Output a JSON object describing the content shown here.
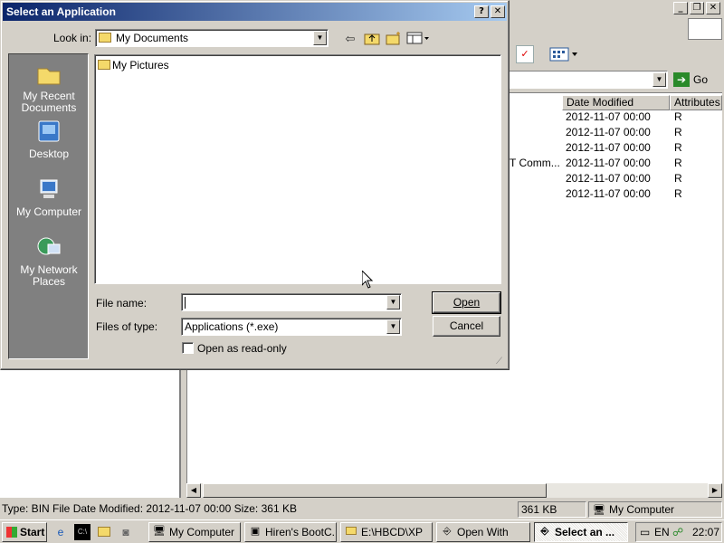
{
  "dialog": {
    "title": "Select an Application",
    "title_buttons": [
      "?",
      "✕"
    ],
    "look_in_label": "Look in:",
    "look_in_value": "My Documents",
    "toolbar_icons": [
      "back-icon",
      "up-folder-icon",
      "new-folder-icon",
      "view-menu-icon"
    ],
    "places": [
      {
        "label": "My Recent Documents",
        "icon": "recent-documents-icon"
      },
      {
        "label": "Desktop",
        "icon": "desktop-icon"
      },
      {
        "label": "My Computer",
        "icon": "my-computer-icon"
      },
      {
        "label": "My Network Places",
        "icon": "network-places-icon"
      }
    ],
    "files": [
      {
        "name": "My Pictures",
        "icon": "folder-icon"
      }
    ],
    "file_name_label": "File name:",
    "file_name_value": "",
    "files_of_type_label": "Files of type:",
    "files_of_type_value": "Applications (*.exe)",
    "read_only_label": "Open as read-only",
    "read_only_checked": false,
    "open_button": "Open",
    "cancel_button": "Cancel"
  },
  "background_window": {
    "caption_buttons": [
      "_",
      "❐",
      "✕"
    ],
    "go_label": "Go",
    "columns": [
      "Date Modified",
      "Attributes"
    ],
    "rows": [
      {
        "name": "",
        "date": "2012-11-07 00:00",
        "attr": "R"
      },
      {
        "name": "",
        "date": "2012-11-07 00:00",
        "attr": "R"
      },
      {
        "name": "",
        "date": "2012-11-07 00:00",
        "attr": "R"
      },
      {
        "name": "T Comm...",
        "date": "2012-11-07 00:00",
        "attr": "R"
      },
      {
        "name": "",
        "date": "2012-11-07 00:00",
        "attr": "R"
      },
      {
        "name": "",
        "date": "2012-11-07 00:00",
        "attr": "R"
      }
    ],
    "status": {
      "info": "Type: BIN File Date Modified: 2012-11-07 00:00 Size: 361 KB",
      "size": "361 KB",
      "location": "My Computer"
    }
  },
  "taskbar": {
    "start_label": "Start",
    "quick_launch": [
      "ie-icon",
      "cmd-icon",
      "folder-icon",
      "media-icon"
    ],
    "tasks": [
      {
        "label": "My Computer",
        "icon": "my-computer-icon",
        "active": false
      },
      {
        "label": "Hiren's BootC...",
        "icon": "hirens-icon",
        "active": false
      },
      {
        "label": "E:\\HBCD\\XP",
        "icon": "folder-icon",
        "active": false
      },
      {
        "label": "Open With",
        "icon": "open-with-icon",
        "active": false
      },
      {
        "label": "Select an ...",
        "icon": "select-app-icon",
        "active": true
      }
    ],
    "tray": {
      "language": "EN",
      "time": "22:07"
    }
  },
  "colors": {
    "title_bar_start": "#0a246a",
    "title_bar_end": "#a6caf0",
    "face": "#d4d0c8",
    "places_bar": "#808080"
  }
}
